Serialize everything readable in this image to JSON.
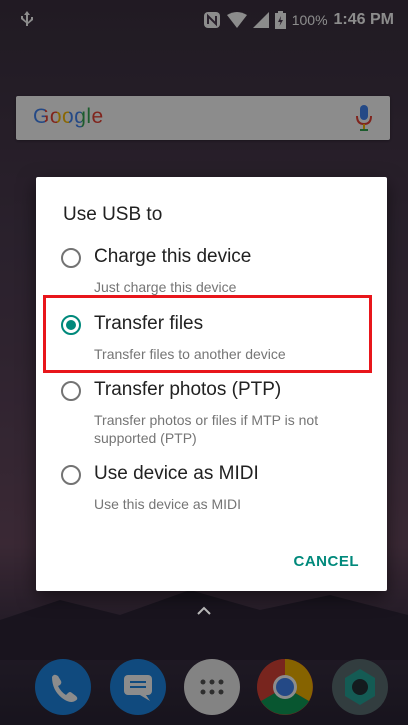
{
  "status_bar": {
    "battery_percent": "100%",
    "time": "1:46 PM",
    "icons": [
      "usb-icon",
      "nfc-icon",
      "wifi-icon",
      "signal-icon",
      "battery-icon"
    ]
  },
  "search": {
    "logo_text": "Google",
    "mic_icon": "mic-icon"
  },
  "dialog": {
    "title": "Use USB to",
    "options": [
      {
        "label": "Charge this device",
        "description": "Just charge this device",
        "selected": false
      },
      {
        "label": "Transfer files",
        "description": "Transfer files to another device",
        "selected": true
      },
      {
        "label": "Transfer photos (PTP)",
        "description": "Transfer photos or files if MTP is not supported (PTP)",
        "selected": false
      },
      {
        "label": "Use device as MIDI",
        "description": "Use this device as MIDI",
        "selected": false
      }
    ],
    "cancel_label": "CANCEL"
  },
  "colors": {
    "accent": "#00897b",
    "highlight": "#e8161b"
  },
  "dock": {
    "apps": [
      "phone-icon",
      "messages-icon",
      "app-drawer-icon",
      "chrome-icon",
      "camera-icon"
    ]
  }
}
